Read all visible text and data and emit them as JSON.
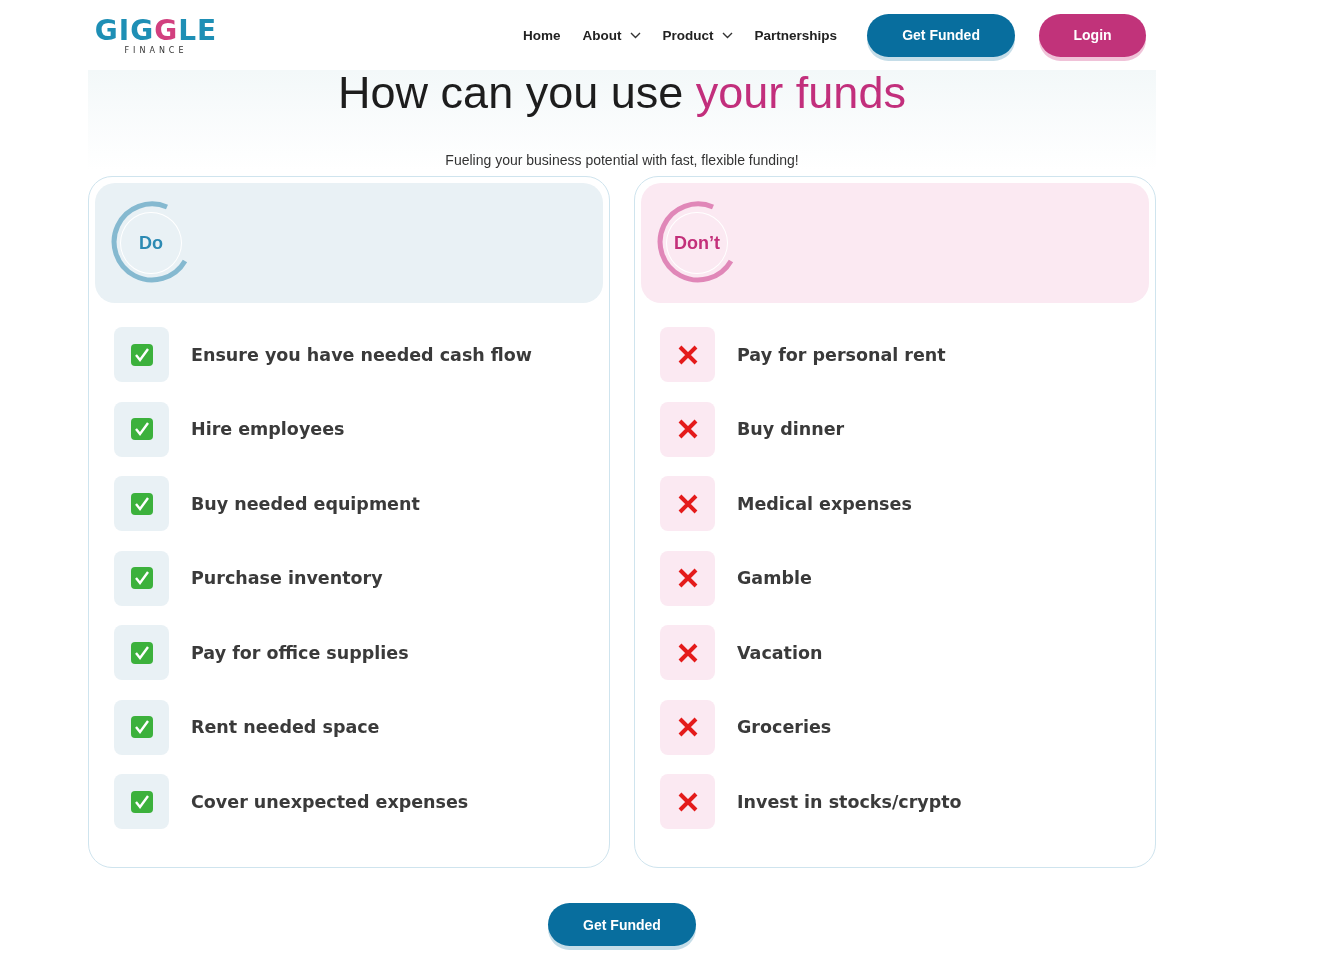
{
  "logo": {
    "wordmark": "GIGGLE",
    "tagline": "FINANCE"
  },
  "nav": [
    {
      "label": "Home",
      "dropdown": false
    },
    {
      "label": "About",
      "dropdown": true
    },
    {
      "label": "Product",
      "dropdown": true
    },
    {
      "label": "Partnerships",
      "dropdown": false
    }
  ],
  "header_buttons": [
    {
      "label": "Get Funded",
      "kind": "primary"
    },
    {
      "label": "Login",
      "kind": "secondary"
    }
  ],
  "heading": {
    "text": "How can you use ",
    "highlight": "your funds"
  },
  "subtitle": "Fueling your business potential with fast, flexible funding!",
  "panels": [
    {
      "kind": "do",
      "title": "Do",
      "items": [
        "Ensure you have needed cash flow",
        "Hire employees",
        "Buy needed equipment",
        "Purchase inventory",
        "Pay for office supplies",
        "Rent needed space",
        "Cover unexpected expenses"
      ]
    },
    {
      "kind": "dont",
      "title": "Don’t",
      "items": [
        "Pay for personal rent",
        "Buy dinner",
        "Medical expenses",
        "Gamble",
        "Vacation",
        "Groceries",
        "Invest in stocks/crypto"
      ]
    }
  ],
  "cta": "Get Funded"
}
